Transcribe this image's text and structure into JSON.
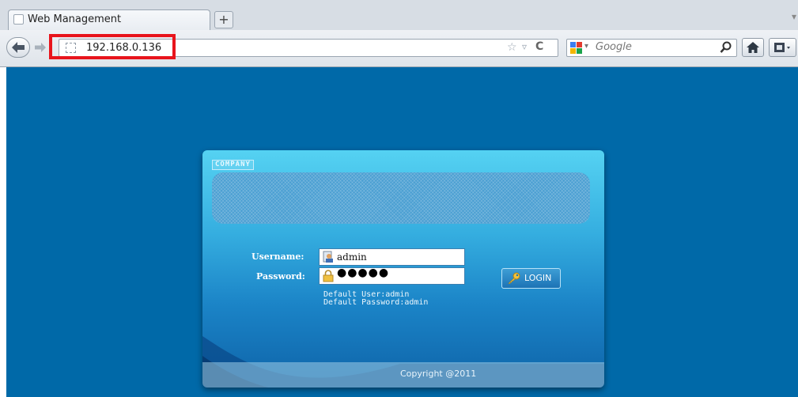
{
  "browser": {
    "tab_title": "Web Management",
    "newtab_label": "+",
    "url": "192.168.0.136",
    "search_placeholder": "Google",
    "tabmenu_glyph": "▾",
    "search_dropdown_glyph": "▾"
  },
  "login": {
    "company": "COMPANY",
    "username_label": "Username:",
    "password_label": "Password:",
    "username_value": "admin",
    "password_masked": "●●●●●",
    "login_button": "LOGIN",
    "default_user": "Default User:admin",
    "default_password": "Default Password:admin",
    "copyright": "Copyright @2011"
  },
  "colors": {
    "page_background": "#0069a8",
    "highlight_box": "#e8141c"
  }
}
